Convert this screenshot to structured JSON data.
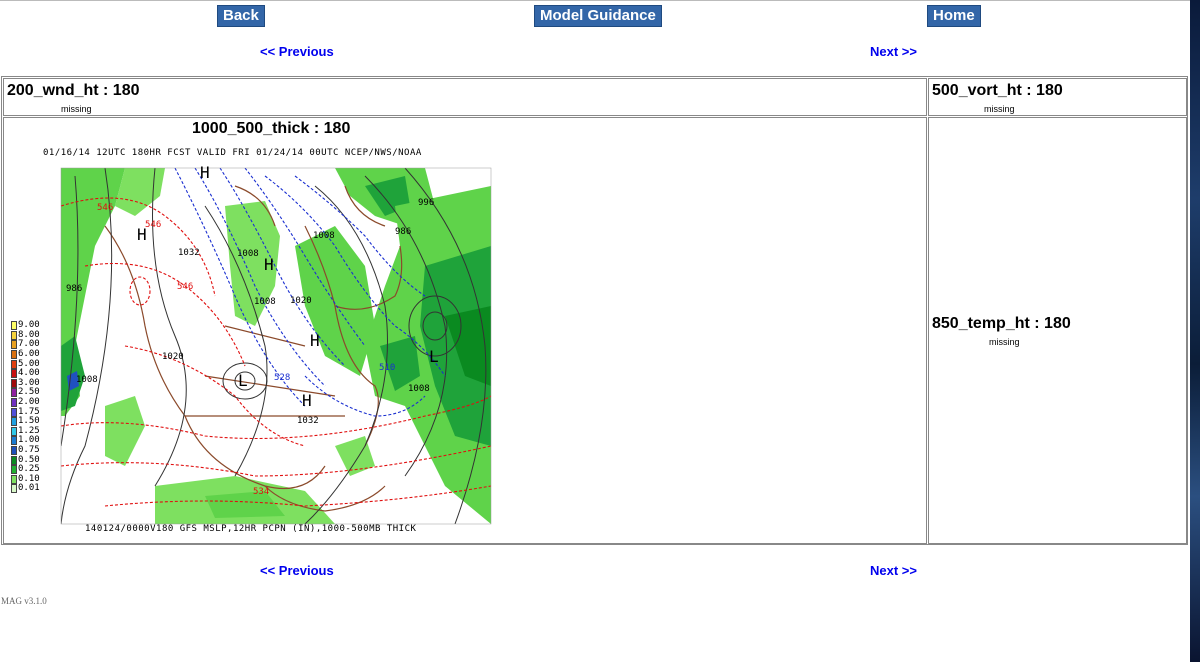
{
  "nav": {
    "back_label": "Back",
    "model_guidance_label": "Model Guidance",
    "home_label": "Home",
    "previous_label": "<< Previous",
    "next_label": "Next >>"
  },
  "cells": {
    "top_left": {
      "title": "200_wnd_ht : 180",
      "status": "missing"
    },
    "top_right": {
      "title": "500_vort_ht : 180",
      "status": "missing"
    },
    "main": {
      "title": "1000_500_thick : 180"
    },
    "right": {
      "title": "850_temp_ht : 180",
      "status": "missing"
    }
  },
  "map": {
    "header": "01/16/14 12UTC  180HR  FCST VALID FRI 01/24/14 00UTC  NCEP/NWS/NOAA",
    "footer": "140124/0000V180 GFS MSLP,12HR PCPN (IN),1000-500MB THICK",
    "legend": [
      {
        "value": "9.00",
        "color": "#ffff66"
      },
      {
        "value": "8.00",
        "color": "#f5d23c"
      },
      {
        "value": "7.00",
        "color": "#e8a020"
      },
      {
        "value": "6.00",
        "color": "#d97010"
      },
      {
        "value": "5.00",
        "color": "#e04010"
      },
      {
        "value": "4.00",
        "color": "#c81010"
      },
      {
        "value": "3.00",
        "color": "#a00a0a"
      },
      {
        "value": "2.50",
        "color": "#9020a0"
      },
      {
        "value": "2.00",
        "color": "#7030c0"
      },
      {
        "value": "1.75",
        "color": "#5050d8"
      },
      {
        "value": "1.50",
        "color": "#20a0e0"
      },
      {
        "value": "1.25",
        "color": "#30c8e8"
      },
      {
        "value": "1.00",
        "color": "#1a7ad0"
      },
      {
        "value": "0.75",
        "color": "#1e4fb8"
      },
      {
        "value": "0.50",
        "color": "#0a8a20"
      },
      {
        "value": "0.25",
        "color": "#20b030"
      },
      {
        "value": "0.10",
        "color": "#7ee060"
      },
      {
        "value": "0.01",
        "color": "#d8f8c8"
      }
    ],
    "pressure_labels": [
      "1008",
      "1032",
      "986",
      "1020",
      "1008",
      "1020",
      "1032",
      "1008",
      "996",
      "986",
      "1008",
      "1008"
    ],
    "thickness_labels": [
      "546",
      "546",
      "546",
      "528",
      "510",
      "534"
    ],
    "centers": [
      "H",
      "H",
      "H",
      "H",
      "H",
      "L",
      "L"
    ]
  },
  "footer": {
    "version": "MAG v3.1.0"
  }
}
